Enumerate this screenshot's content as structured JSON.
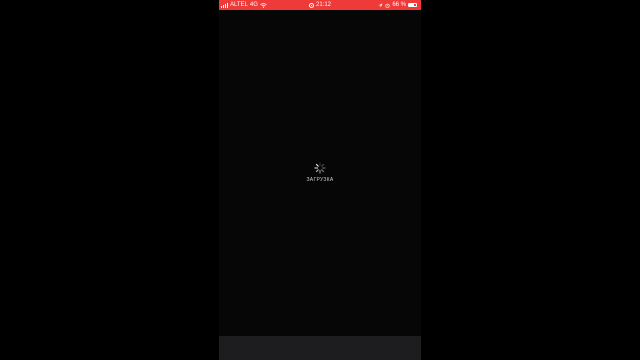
{
  "status_bar": {
    "carrier": "ALTEL",
    "network": "4G",
    "time": "21:12",
    "battery_percent": "66 %",
    "battery_level": 0.66,
    "background_color": "#ef3a3a"
  },
  "loading": {
    "label": "ЗАГРУЗКА"
  },
  "icons": {
    "signal": "signal-bars-icon",
    "wifi": "wifi-icon",
    "recording": "screen-recording-icon",
    "location": "location-arrow-icon",
    "alarm": "alarm-icon",
    "battery": "battery-icon",
    "spinner": "loading-spinner-icon"
  }
}
